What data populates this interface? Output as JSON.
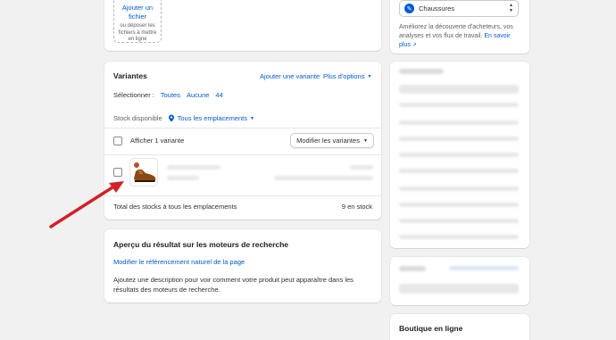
{
  "upload": {
    "link": "Ajouter un fichier",
    "hint": "ou déposer les fichiers à mettre en ligne"
  },
  "variants": {
    "title": "Variantes",
    "add_variant": "Ajouter une variante",
    "more_options": "Plus d'options",
    "select_label": "Sélectionner :",
    "select_all": "Toutes",
    "select_none": "Aucune",
    "select_count": "44",
    "stock_label": "Stock disponible",
    "stock_locations": "Tous les emplacements",
    "show_variant": "Afficher 1 variante",
    "edit_variants": "Modifier les variantes",
    "total_label": "Total des stocks à tous les emplacements",
    "total_value": "9 en stock"
  },
  "seo": {
    "title": "Aperçu du résultat sur les moteurs de recherche",
    "edit_link": "Modifier le référencement naturel de la page",
    "description": "Ajoutez une description pour voir comment votre produit peut apparaître dans les résultats des moteurs de recherche."
  },
  "category": {
    "value": "Chaussures",
    "help": "Améliorez la découverte d'acheteurs, vos analyses et vos flux de travail.",
    "learn_more": "En savoir plus"
  },
  "store": {
    "title": "Boutique en ligne"
  },
  "colors": {
    "accent": "#005bd3",
    "arrow": "#d32027",
    "background": "#f1f1f1"
  }
}
